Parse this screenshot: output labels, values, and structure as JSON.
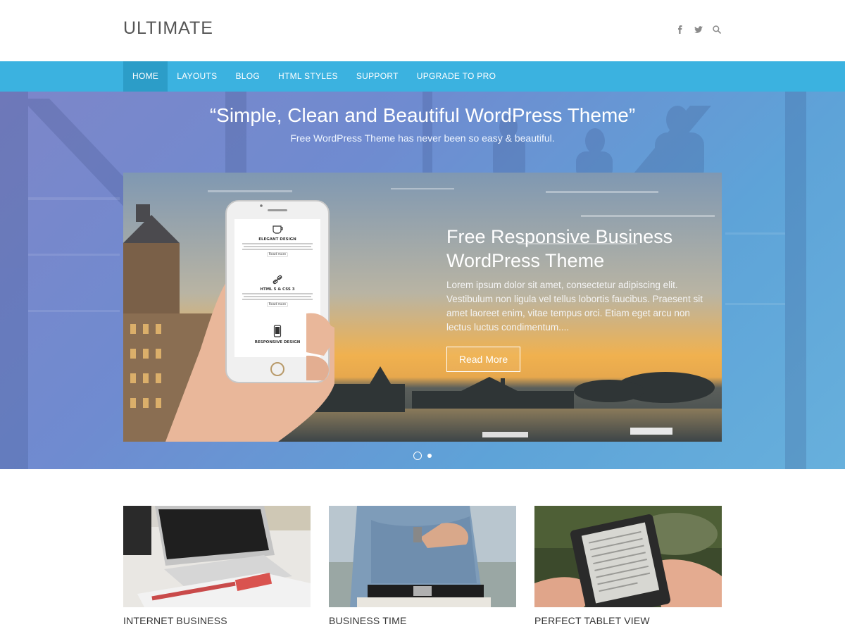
{
  "site": {
    "title": "ULTIMATE"
  },
  "social": [
    {
      "name": "facebook-icon"
    },
    {
      "name": "twitter-icon"
    },
    {
      "name": "search-icon"
    }
  ],
  "nav": {
    "items": [
      {
        "label": "HOME",
        "active": true
      },
      {
        "label": "LAYOUTS"
      },
      {
        "label": "BLOG"
      },
      {
        "label": "HTML STYLES"
      },
      {
        "label": "SUPPORT"
      },
      {
        "label": "UPGRADE TO PRO"
      }
    ]
  },
  "hero": {
    "quote": "“Simple, Clean and Beautiful WordPress Theme”",
    "subtitle": "Free WordPress Theme has never been so easy & beautiful.",
    "slide": {
      "title": "Free Responsive Business WordPress Theme",
      "text": "Lorem ipsum dolor sit amet, consectetur adipiscing elit. Vestibulum non ligula vel tellus lobortis faucibus. Praesent sit amet laoreet enim, vitae tempus orci. Etiam eget arcu non lectus luctus condimentum....",
      "button": "Read More",
      "phone": {
        "items": [
          {
            "title": "ELEGANT DESIGN",
            "button": "Read more"
          },
          {
            "title": "HTML 5 & CSS 3",
            "button": "Read more"
          },
          {
            "title": "RESPONSIVE DESIGN"
          }
        ]
      }
    },
    "dots": {
      "count": 2,
      "active_index": 0
    }
  },
  "features": [
    {
      "label": "INTERNET BUSINESS",
      "image": "laptop with newspaper"
    },
    {
      "label": "BUSINESS TIME",
      "image": "man checking wristwatch"
    },
    {
      "label": "PERFECT TABLET VIEW",
      "image": "hands holding e-reader"
    }
  ],
  "colors": {
    "nav_bg": "#3bb2e0",
    "nav_active": "#2c9dc8",
    "hero_start": "#7d86c9",
    "hero_end": "#67b0dc"
  }
}
